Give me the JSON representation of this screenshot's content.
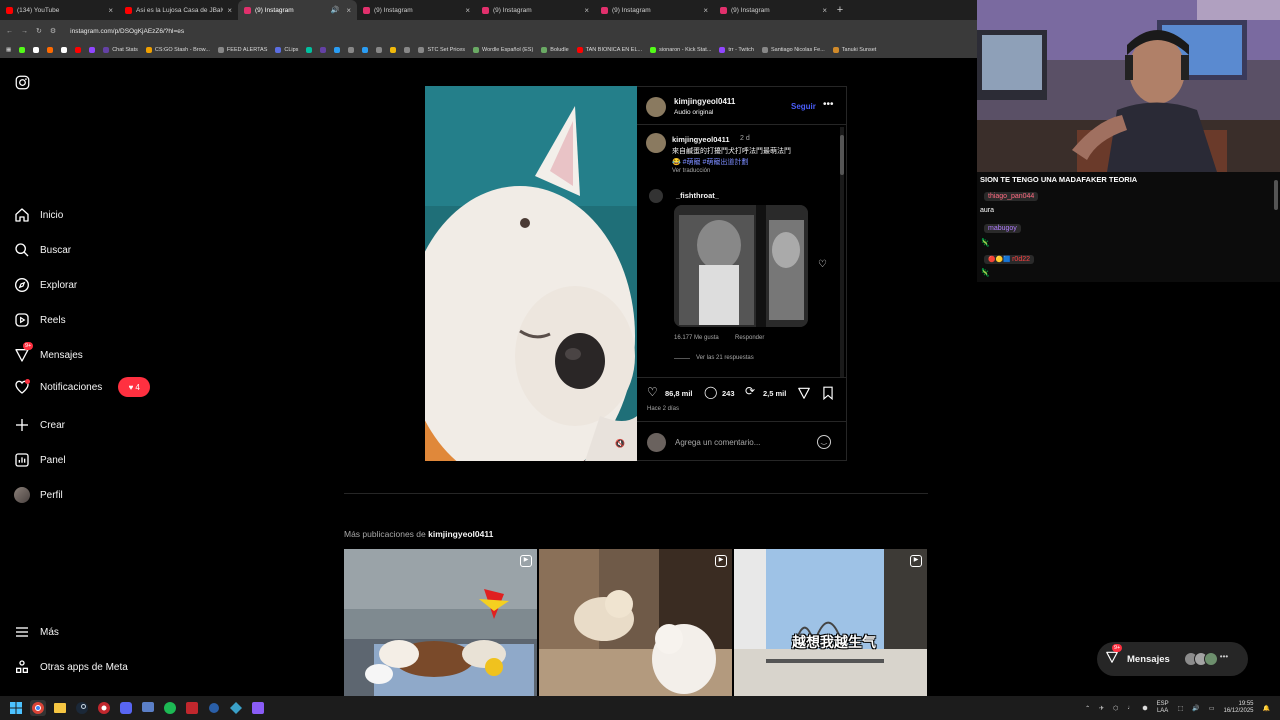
{
  "browser": {
    "tabs": [
      {
        "title": "(134) YouTube",
        "color": "#ff0000"
      },
      {
        "title": "Asi es la Lujosa Casa de JBalvin",
        "color": "#ff0000"
      },
      {
        "title": "(9) Instagram",
        "color": "#e1306c",
        "active": true
      },
      {
        "title": "(9) Instagram",
        "color": "#e1306c"
      },
      {
        "title": "(9) Instagram",
        "color": "#e1306c"
      },
      {
        "title": "(9) Instagram",
        "color": "#e1306c"
      },
      {
        "title": "(9) Instagram",
        "color": "#e1306c"
      }
    ],
    "url": "instagram.com/p/DSOgKjAEzZ6/?hl=es",
    "bookmarks": [
      {
        "label": "Chat Stats",
        "color": "#6441a5"
      },
      {
        "label": "CS:GO Stash - Brow...",
        "color": "#f0a000"
      },
      {
        "label": "FEED ALERTAS",
        "color": "#888888"
      },
      {
        "label": "CLips",
        "color": "#5b6ee1"
      },
      {
        "label": "STC Set Prices",
        "color": "#888888"
      },
      {
        "label": "Wordle Español (ES)",
        "color": "#6aaa64"
      },
      {
        "label": "Boludle",
        "color": "#6aaa64"
      },
      {
        "label": "TAN BIONICA EN EL...",
        "color": "#ff0000"
      },
      {
        "label": "sionaron - Kick Stat...",
        "color": "#53fc18"
      },
      {
        "label": "trr - Twitch",
        "color": "#9146ff"
      },
      {
        "label": "Santiago Nicolas Fe...",
        "color": "#888888"
      },
      {
        "label": "Tanuki Sunset",
        "color": "#d08a2a"
      }
    ]
  },
  "sidebar": {
    "items": [
      {
        "label": "Inicio"
      },
      {
        "label": "Buscar"
      },
      {
        "label": "Explorar"
      },
      {
        "label": "Reels"
      },
      {
        "label": "Mensajes",
        "badge": "9+"
      },
      {
        "label": "Notificaciones",
        "badge": "4"
      },
      {
        "label": "Crear"
      },
      {
        "label": "Panel"
      },
      {
        "label": "Perfil"
      },
      {
        "label": "Más"
      },
      {
        "label": "Otras apps de Meta"
      }
    ]
  },
  "post": {
    "author": "kimjingyeol0411",
    "audio": "Audio original",
    "follow": "Seguir",
    "caption_author": "kimjingyeol0411",
    "caption_time": "2 d",
    "caption_text": "來自鹹蛋的打擾鬥犬打呼法鬥最萌法鬥",
    "caption_tags": "😂 #萌寵 #萌寵出道計劃",
    "translate": "Ver traducción",
    "comment_user": "_fishthroat_",
    "comment_likes": "16.177 Me gusta",
    "reply": "Responder",
    "view_replies": "Ver las 21 respuestas",
    "likes": "86,8 mil",
    "comments": "243",
    "reposts": "2,5 mil",
    "time_ago": "Hace 2 días",
    "comment_placeholder": "Agrega un comentario..."
  },
  "more": {
    "prefix": "Más publicaciones de",
    "author": "kimjingyeol0411",
    "thumb3_text": "越想我越生气"
  },
  "messages_pill": {
    "label": "Mensajes",
    "badge": "9+"
  },
  "stream_chat": {
    "title": "SION TE TENGO UNA MADAFAKER TEORIA",
    "lines": [
      {
        "user": "thiago_pan044",
        "color": "#ff6b81"
      },
      {
        "text": "aura"
      },
      {
        "user": "mabugoy",
        "color": "#b07cff"
      },
      {
        "user": "r0d22",
        "color": "#ff4040"
      }
    ]
  },
  "taskbar": {
    "lang": "ESP",
    "lang2": "LAA",
    "time": "19:55",
    "date": "16/12/2025"
  }
}
